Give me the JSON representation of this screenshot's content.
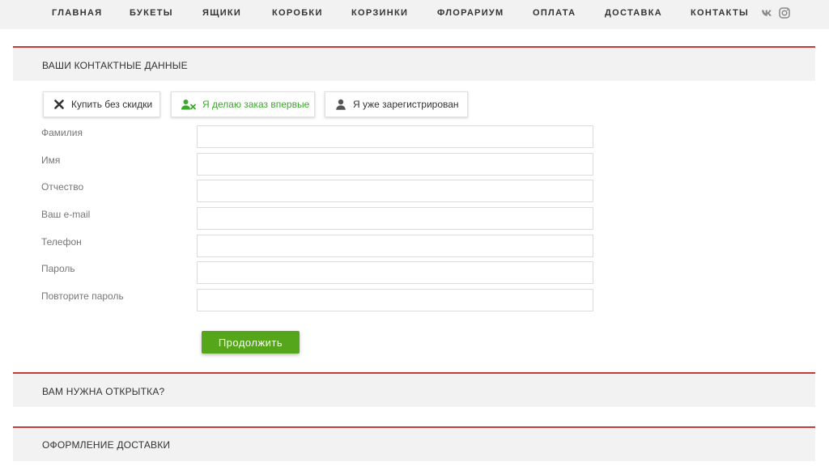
{
  "nav": {
    "items": [
      "ГЛАВНАЯ",
      "БУКЕТЫ",
      "ЯЩИКИ",
      "КОРОБКИ",
      "КОРЗИНКИ",
      "ФЛОРАРИУМ",
      "ОПЛАТА",
      "ДОСТАВКА",
      "КОНТАКТЫ"
    ],
    "social": [
      "vk-icon",
      "instagram-icon"
    ]
  },
  "sections": {
    "contact": "ВАШИ КОНТАКТНЫЕ ДАННЫЕ",
    "postcard": "ВАМ НУЖНА ОТКРЫТКА?",
    "delivery": "ОФОРМЛЕНИЕ ДОСТАВКИ"
  },
  "tabs": [
    {
      "label": "Купить без скидки",
      "icon": "close-icon",
      "active": false
    },
    {
      "label": "Я делаю заказ впервые",
      "icon": "add-user-icon",
      "active": true
    },
    {
      "label": "Я уже зарегистрирован",
      "icon": "user-icon",
      "active": false
    }
  ],
  "fields": [
    {
      "label": "Фамилия",
      "value": ""
    },
    {
      "label": "Имя",
      "value": ""
    },
    {
      "label": "Отчество",
      "value": ""
    },
    {
      "label": "Ваш e-mail",
      "value": ""
    },
    {
      "label": "Телефон",
      "value": ""
    },
    {
      "label": "Пароль",
      "value": ""
    },
    {
      "label": "Повторите пароль",
      "value": ""
    }
  ],
  "continue_label": "Продолжить",
  "colors": {
    "accent_red": "#c9393b",
    "active_green": "#3aa829",
    "button_green": "#55a61b",
    "section_bg": "#f2f2f2"
  }
}
